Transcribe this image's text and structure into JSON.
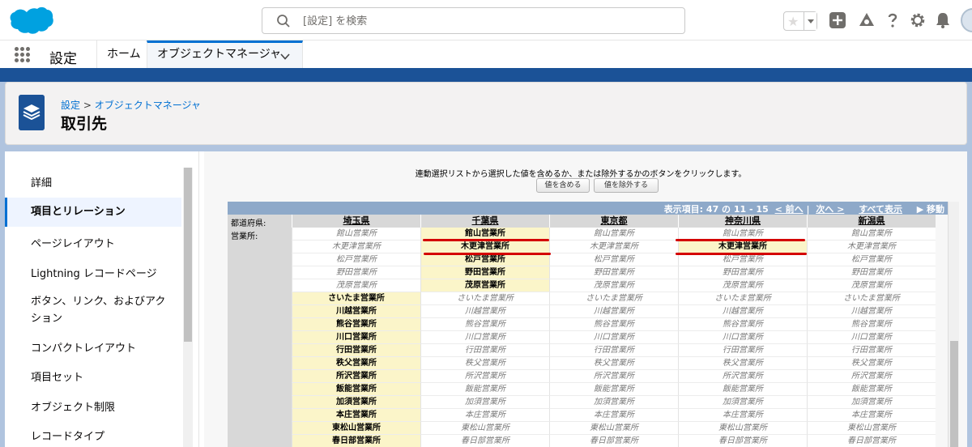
{
  "header": {
    "search_placeholder": "[設定] を検索",
    "brand_color": "#00a1e0"
  },
  "nav": {
    "app_name": "設定",
    "tabs": [
      {
        "label": "ホーム"
      },
      {
        "label": "オブジェクトマネージャ"
      }
    ]
  },
  "page_header": {
    "breadcrumb_root": "設定",
    "breadcrumb_sep": ">",
    "breadcrumb_current": "オブジェクトマネージャ",
    "title": "取引先"
  },
  "sidebar": {
    "items": [
      {
        "label": "詳細"
      },
      {
        "label": "項目とリレーション"
      },
      {
        "label": "ページレイアウト"
      },
      {
        "label": "Lightning レコードページ"
      },
      {
        "label": "ボタン、リンク、およびアクション"
      },
      {
        "label": "コンパクトレイアウト"
      },
      {
        "label": "項目セット"
      },
      {
        "label": "オブジェクト制限"
      },
      {
        "label": "レコードタイプ"
      }
    ]
  },
  "content": {
    "instruction": "連動選択リストから選択した値を含めるか、または除外するかのボタンをクリックします。",
    "include_button": "値を含める",
    "exclude_button": "値を除外する",
    "table_info": "表示項目: 47 の 11 - 15",
    "prev_link": "< 前へ",
    "next_link": "次へ >",
    "show_all_link": "すべて表示",
    "move_label": "▶ 移動",
    "controlling_field_label": "都道府県:",
    "dependent_field_label": "営業所:",
    "columns": [
      "埼玉県",
      "千葉県",
      "東京都",
      "神奈川県",
      "新潟県"
    ],
    "rows": [
      "館山営業所",
      "木更津営業所",
      "松戸営業所",
      "野田営業所",
      "茂原営業所",
      "さいたま営業所",
      "川越営業所",
      "熊谷営業所",
      "川口営業所",
      "行田営業所",
      "秩父営業所",
      "所沢営業所",
      "飯能営業所",
      "加須営業所",
      "本庄営業所",
      "東松山営業所",
      "春日部営業所"
    ],
    "selected": [
      [
        false,
        true,
        false,
        false,
        false
      ],
      [
        false,
        true,
        false,
        true,
        false
      ],
      [
        false,
        true,
        false,
        false,
        false
      ],
      [
        false,
        true,
        false,
        false,
        false
      ],
      [
        false,
        true,
        false,
        false,
        false
      ],
      [
        true,
        false,
        false,
        false,
        false
      ],
      [
        true,
        false,
        false,
        false,
        false
      ],
      [
        true,
        false,
        false,
        false,
        false
      ],
      [
        true,
        false,
        false,
        false,
        false
      ],
      [
        true,
        false,
        false,
        false,
        false
      ],
      [
        true,
        false,
        false,
        false,
        false
      ],
      [
        true,
        false,
        false,
        false,
        false
      ],
      [
        true,
        false,
        false,
        false,
        false
      ],
      [
        true,
        false,
        false,
        false,
        false
      ],
      [
        true,
        false,
        false,
        false,
        false
      ],
      [
        true,
        false,
        false,
        false,
        false
      ],
      [
        true,
        false,
        false,
        false,
        false
      ]
    ]
  }
}
